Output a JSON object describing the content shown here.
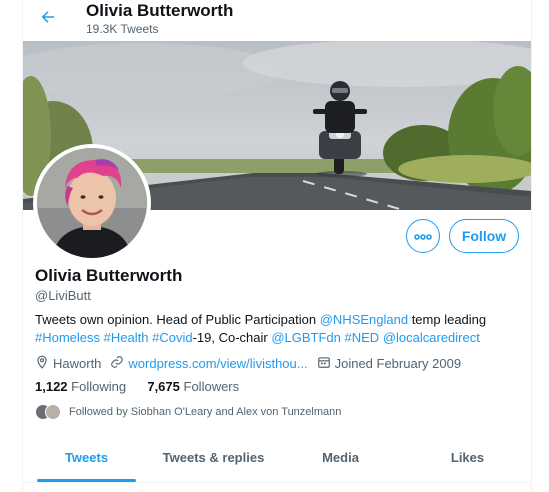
{
  "header": {
    "name": "Olivia Butterworth",
    "tweet_count": "19.3K Tweets",
    "back_icon": "arrow-left-icon"
  },
  "profile": {
    "name": "Olivia Butterworth",
    "handle": "@LiviButt",
    "follow_label": "Follow",
    "more_icon": "ellipsis-icon",
    "bio": {
      "t1": "Tweets own opinion. Head of Public Participation ",
      "l1": "@NHSEngland",
      "t2": " temp leading",
      "l2": "#Homeless",
      "l3": "#Health",
      "l4": "#Covid",
      "t3": "-19, Co-chair ",
      "l5": "@LGBTFdn",
      "l6": "#NED",
      "l7": "@localcaredirect"
    },
    "location": "Haworth",
    "website": "wordpress.com/view/livisthou...",
    "joined": "Joined February 2009",
    "following_count": "1,122",
    "following_label": "Following",
    "followers_count": "7,675",
    "followers_label": "Followers",
    "followed_by": "Followed by Siobhan O'Leary and Alex von Tunzelmann"
  },
  "tabs": [
    {
      "label": "Tweets",
      "active": true
    },
    {
      "label": "Tweets & replies",
      "active": false
    },
    {
      "label": "Media",
      "active": false
    },
    {
      "label": "Likes",
      "active": false
    }
  ],
  "colors": {
    "accent": "#1d9bf0",
    "text": "#0f1419",
    "muted": "#536471"
  }
}
